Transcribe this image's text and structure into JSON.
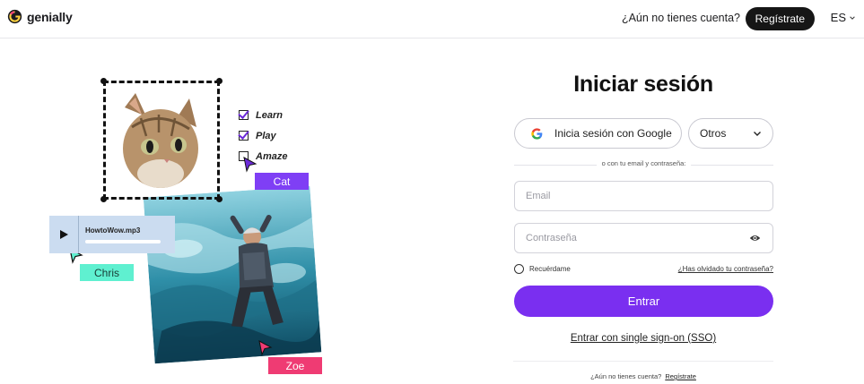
{
  "header": {
    "brand": "genially",
    "no_account_text": "¿Aún no tienes cuenta?",
    "register_label": "Regístrate",
    "language": "ES"
  },
  "illustration": {
    "checklist": [
      {
        "label": "Learn",
        "checked": true
      },
      {
        "label": "Play",
        "checked": true
      },
      {
        "label": "Amaze",
        "checked": false
      }
    ],
    "tags": {
      "cat": "Cat",
      "chris": "Chris",
      "zoe": "Zoe"
    },
    "audio_file": "HowtoWow.mp3"
  },
  "login": {
    "title": "Iniciar sesión",
    "google_label": "Inicia sesión con Google",
    "others_label": "Otros",
    "divider_text": "o con tu email y contraseña:",
    "email_placeholder": "Email",
    "password_placeholder": "Contraseña",
    "remember_label": "Recuérdame",
    "forgot_label": "¿Has olvidado tu contraseña?",
    "enter_label": "Entrar",
    "sso_label": "Entrar con single sign-on (SSO)",
    "bottom_prompt": "¿Aún no tienes cuenta?",
    "bottom_register": "Regístrate"
  },
  "colors": {
    "primary": "#7a2ff0",
    "cat_tag": "#7f3ff5",
    "chris_tag": "#5ff0d0",
    "zoe_tag": "#ef3b73",
    "dark_button": "#161616"
  }
}
